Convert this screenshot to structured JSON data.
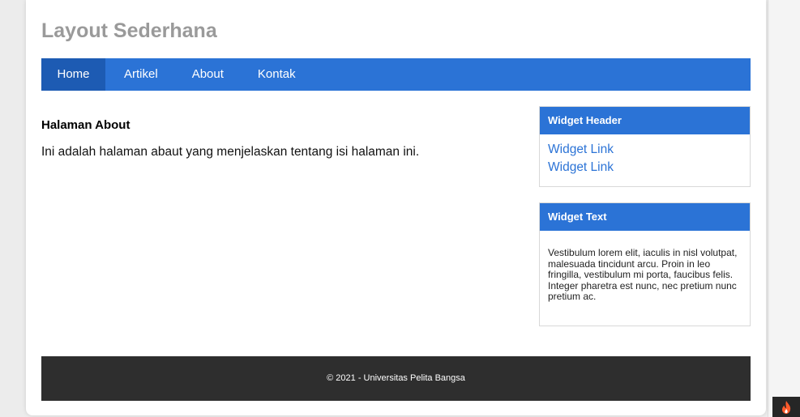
{
  "header": {
    "title": "Layout Sederhana"
  },
  "nav": {
    "items": [
      {
        "label": "Home"
      },
      {
        "label": "Artikel"
      },
      {
        "label": "About"
      },
      {
        "label": "Kontak"
      }
    ]
  },
  "content": {
    "title": "Halaman About",
    "body": "Ini adalah halaman abaut yang menjelaskan tentang isi halaman ini."
  },
  "sidebar": {
    "widget_links": {
      "header": "Widget Header",
      "links": [
        {
          "label": "Widget Link"
        },
        {
          "label": "Widget Link"
        }
      ]
    },
    "widget_text": {
      "header": "Widget Text",
      "body": "Vestibulum lorem elit, iaculis in nisl volutpat, malesuada tincidunt arcu. Proin in leo fringilla, vestibulum mi porta, faucibus felis. Integer pharetra est nunc, nec pretium nunc pretium ac."
    }
  },
  "footer": {
    "text": "© 2021 - Universitas Pelita Bangsa"
  },
  "colors": {
    "accent": "#2b73d6",
    "nav_active": "#1d5bb3",
    "footer_bg": "#2e2e2e",
    "title_gray": "#9a9a9a",
    "badge_flame": "#ff5a2b"
  },
  "icons": {
    "corner_badge": "flame-icon"
  }
}
